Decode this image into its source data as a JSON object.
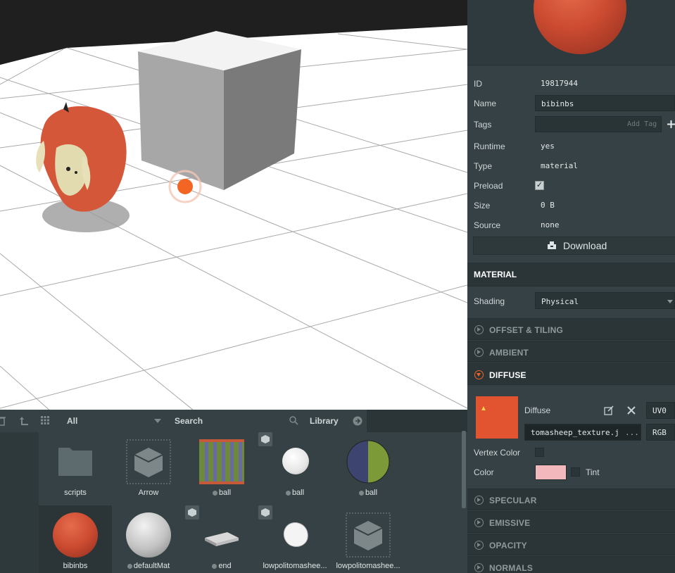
{
  "inspector": {
    "rows": [
      {
        "label": "ID",
        "value": "19817944"
      },
      {
        "label": "Name",
        "value": "bibinbs"
      },
      {
        "label": "Tags",
        "placeholder": "Add Tag"
      },
      {
        "label": "Runtime",
        "value": "yes"
      },
      {
        "label": "Type",
        "value": "material"
      },
      {
        "label": "Preload",
        "checked": true
      },
      {
        "label": "Size",
        "value": "0 B"
      },
      {
        "label": "Source",
        "value": "none"
      }
    ],
    "download_label": "Download",
    "material_header": "MATERIAL",
    "shading_label": "Shading",
    "shading_value": "Physical",
    "sections": [
      "OFFSET & TILING",
      "AMBIENT",
      "DIFFUSE",
      "SPECULAR",
      "EMISSIVE",
      "OPACITY",
      "NORMALS"
    ],
    "diffuse": {
      "map_label": "Diffuse",
      "texture": "tomasheep_texture.jpg",
      "more": "...",
      "uv": "UV0",
      "channel": "RGB",
      "vertex_color_label": "Vertex Color",
      "color_label": "Color",
      "color_swatch": "#f3b8bc",
      "tint_label": "Tint"
    },
    "colors": {
      "accent": "#f26522",
      "panel": "#364145"
    }
  },
  "assets": {
    "filter": "All",
    "search_label": "Search",
    "library_label": "Library",
    "items": [
      {
        "label": "scripts",
        "kind": "folder"
      },
      {
        "label": "Arrow",
        "kind": "template"
      },
      {
        "label": "ball",
        "kind": "texture",
        "dot": true
      },
      {
        "label": "ball",
        "kind": "material-white",
        "dot": true
      },
      {
        "label": "ball",
        "kind": "material-split",
        "dot": true
      },
      {
        "label": "bibinbs",
        "kind": "material-red",
        "selected": true
      },
      {
        "label": "defaultMat",
        "kind": "material-grey",
        "dot": true
      },
      {
        "label": "end",
        "kind": "model",
        "dot": true
      },
      {
        "label": "lowpolitomashee...",
        "kind": "model-sheep"
      },
      {
        "label": "lowpolitomashee...",
        "kind": "template"
      }
    ]
  },
  "icons": [
    "delete-icon",
    "upload-icon",
    "grid-icon",
    "dropdown-caret-icon",
    "search-icon",
    "arrow-right-icon",
    "edit-icon",
    "close-icon",
    "plus-icon",
    "download-icon",
    "folder-icon",
    "cube-icon"
  ]
}
